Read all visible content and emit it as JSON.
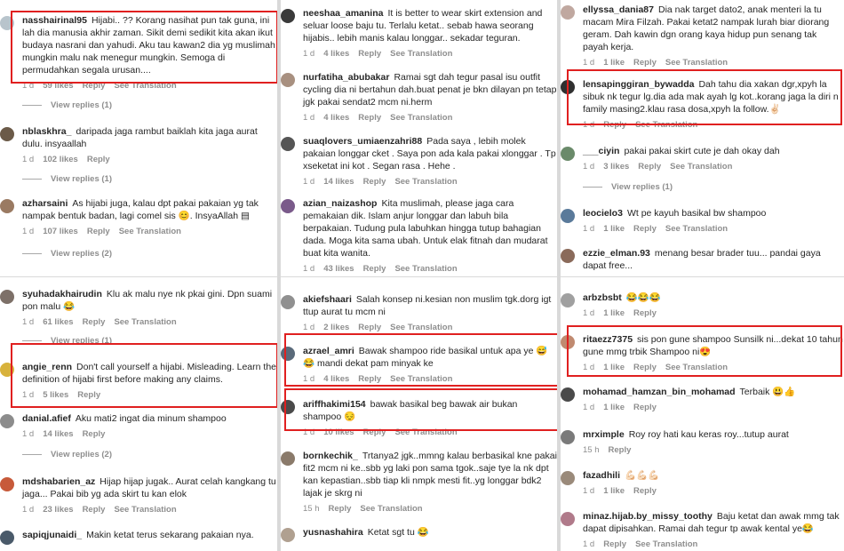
{
  "strings": {
    "like": "Like",
    "reply": "Reply",
    "see_translation": "See Translation"
  },
  "colors": {
    "highlight": "#e02020",
    "text": "#262626",
    "meta": "#8e8e8e",
    "divider": "#d9d9d9"
  },
  "panels": [
    {
      "comments": [
        {
          "user": "nasshairinal95",
          "text": "Hijabi.. ?? Korang nasihat pun tak guna, ini lah dia manusia akhir zaman. Sikit demi sedikit kita akan ikut budaya nasrani dan yahudi. Aku tau kawan2 dia yg muslimah mungkin malu nak menegur mungkin. Semoga di permudahkan segala urusan....",
          "time": "1 d",
          "likes": "59 likes",
          "avatar": "#b8c4cc",
          "translate": true
        },
        {
          "replies": "View replies (1)"
        },
        {
          "user": "nblaskhra_",
          "text": "daripada jaga rambut baiklah kita jaga aurat dulu. insyaallah",
          "time": "1 d",
          "likes": "102 likes",
          "avatar": "#6b5a48",
          "translate": false
        },
        {
          "replies": "View replies (1)"
        },
        {
          "user": "azharsaini",
          "text": "As hijabi juga, kalau dpt pakai pakaian yg tak nampak bentuk badan, lagi comel sis 😊. InsyaAllah ▤",
          "time": "1 d",
          "likes": "107 likes",
          "avatar": "#9a7a62",
          "translate": true
        },
        {
          "replies": "View replies (2)"
        }
      ]
    },
    {
      "comments": [
        {
          "user": "syuhadakhairudin",
          "text": "Klu ak malu nye nk pkai gini. Dpn suami pon malu 😂",
          "time": "1 d",
          "likes": "61 likes",
          "avatar": "#7d7068",
          "translate": true
        },
        {
          "replies": "View replies (1)"
        },
        {
          "user": "angie_renn",
          "text": "Don't call yourself a hijabi. Misleading. Learn the definition of hijabi first before making any claims.",
          "time": "1 d",
          "likes": "5 likes",
          "avatar": "#d8b23c",
          "translate": false
        },
        {
          "user": "danial.afief",
          "text": "Aku mati2 ingat dia minum shampoo",
          "time": "1 d",
          "likes": "14 likes",
          "avatar": "#8c8c8c",
          "translate": false
        },
        {
          "replies": "View replies (2)"
        },
        {
          "user": "mdshabarien_az",
          "text": "Hijap hijap jugak.. Aurat celah kangkang tu jaga... Pakai bib yg ada skirt tu kan elok",
          "time": "1 d",
          "likes": "23 likes",
          "avatar": "#c75a3a",
          "translate": true
        },
        {
          "user": "sapiqjunaidi_",
          "text": "Makin ketat terus sekarang pakaian nya.",
          "time": "",
          "likes": "",
          "avatar": "#4a5a6a",
          "translate": false
        }
      ]
    },
    {
      "comments": [
        {
          "user": "neeshaa_amanina",
          "text": "It is better to wear skirt extension and seluar loose baju tu. Terlalu ketat.. sebab hawa seorang hijabis.. lebih manis kalau longgar.. sekadar teguran.",
          "time": "1 d",
          "likes": "4 likes",
          "avatar": "#3a3a3a",
          "translate": true
        },
        {
          "user": "nurfatiha_abubakar",
          "text": "Ramai sgt dah tegur pasal isu outfit cycling dia ni bertahun dah.buat penat je bkn dilayan pn tetap jgk pakai sendat2 mcm ni.herm",
          "time": "1 d",
          "likes": "4 likes",
          "avatar": "#a89080",
          "translate": true
        },
        {
          "user": "suaqlovers_umiaenzahri88",
          "text": "Pada saya , lebih molek pakaian longgar cket . Saya pon ada kala pakai xlonggar . Tp xseketat ini kot . Segan rasa . Hehe .",
          "time": "1 d",
          "likes": "14 likes",
          "avatar": "#555555",
          "translate": true
        },
        {
          "user": "azian_naizashop",
          "text": "Kita muslimah, please jaga cara pemakaian dik. Islam anjur longgar dan labuh bila berpakaian. Tudung pula labuhkan hingga tutup bahagian dada. Moga kita sama ubah. Untuk elak fitnah dan mudarat buat kita wanita.",
          "time": "1 d",
          "likes": "43 likes",
          "avatar": "#7a5a8a",
          "translate": true
        }
      ]
    },
    {
      "comments": [
        {
          "user": "akiefshaari",
          "text": "Salah konsep ni.kesian non muslim tgk.dorg igt ttup aurat tu mcm ni",
          "time": "1 d",
          "likes": "2 likes",
          "avatar": "#909090",
          "translate": true
        },
        {
          "user": "azrael_amri",
          "text": "Bawak shampoo ride basikal untuk apa ye 😅 😂 mandi dekat pam minyak ke",
          "time": "1 d",
          "likes": "4 likes",
          "avatar": "#5a6a7a",
          "translate": true
        },
        {
          "user": "ariffhakimi154",
          "text": "bawak basikal beg bawak air bukan shampoo 😔",
          "time": "1 d",
          "likes": "10 likes",
          "avatar": "#4a4a4a",
          "translate": true
        },
        {
          "user": "bornkechik_",
          "text": "Trtanya2 jgk..mmng kalau berbasikal kne pakai fit2 mcm ni ke..sbb yg laki pon sama tgok..saje tye la nk dpt kan kepastian..sbb tiap kli nmpk mesti fit..yg longgar bdk2 lajak je skrg ni",
          "time": "15 h",
          "likes": "",
          "avatar": "#8a7a6a",
          "translate": true
        },
        {
          "user": "yusnashahira",
          "text": "Ketat sgt tu 😂",
          "time": "",
          "likes": "",
          "avatar": "#b0a090",
          "translate": false
        }
      ]
    },
    {
      "comments": [
        {
          "user": "ellyssa_dania87",
          "text": "Dia nak target dato2, anak menteri la tu macam Mira Filzah. Pakai ketat2 nampak lurah biar diorang geram. Dah kawin dgn orang kaya hidup pun senang tak payah kerja.",
          "time": "1 d",
          "likes": "1 like",
          "avatar": "#c0a8a0",
          "translate": true
        },
        {
          "user": "lensapinggiran_bywadda",
          "text": "Dah tahu dia xakan dgr,xpyh la sibuk nk tegur lg.dia ada mak ayah lg kot..korang jaga la diri n family masing2.klau rasa dosa,xpyh la follow.✌🏻",
          "time": "1 d",
          "likes": "",
          "avatar": "#303030",
          "translate": true
        },
        {
          "user": "___ciyin",
          "text": "pakai pakai skirt cute je dah okay dah",
          "time": "1 d",
          "likes": "3 likes",
          "avatar": "#6a8a6a",
          "translate": true
        },
        {
          "replies": "View replies (1)"
        },
        {
          "user": "leocielo3",
          "text": "Wt pe kayuh basikal bw shampoo",
          "time": "1 d",
          "likes": "1 like",
          "avatar": "#5a7a9a",
          "translate": true
        },
        {
          "user": "ezzie_elman.93",
          "text": "menang besar brader tuu... pandai gaya dapat free...",
          "time": "",
          "likes": "",
          "avatar": "#8a6a5a",
          "translate": false
        }
      ]
    },
    {
      "comments": [
        {
          "user": "arbzbsbt",
          "text": "😂😂😂",
          "time": "1 d",
          "likes": "1 like",
          "avatar": "#a0a0a0",
          "translate": false
        },
        {
          "user": "ritaezz7375",
          "text": "sis pon gune shampoo Sunsilk ni...dekat 10 tahun gune mmg trbik Shampoo ni😍",
          "time": "1 d",
          "likes": "1 like",
          "avatar": "#c08a70",
          "translate": true
        },
        {
          "user": "mohamad_hamzan_bin_mohamad",
          "text": "Terbaik 😃👍",
          "time": "1 d",
          "likes": "1 like",
          "avatar": "#4a4a4a",
          "translate": false
        },
        {
          "user": "mrximple",
          "text": "Roy roy hati kau keras roy...tutup aurat",
          "time": "15 h",
          "likes": "",
          "avatar": "#7a7a7a",
          "translate": false
        },
        {
          "user": "fazadhili",
          "text": "💪🏻💪🏻💪🏻",
          "time": "1 d",
          "likes": "1 like",
          "avatar": "#9a8a7a",
          "translate": false
        },
        {
          "user": "minaz.hijab.by_missy_toothy",
          "text": "Baju ketat dan awak mmg tak dapat dipisahkan. Ramai dah tegur tp awak kental ye😂",
          "time": "1 d",
          "likes": "",
          "avatar": "#b07a8a",
          "translate": true
        }
      ]
    }
  ]
}
